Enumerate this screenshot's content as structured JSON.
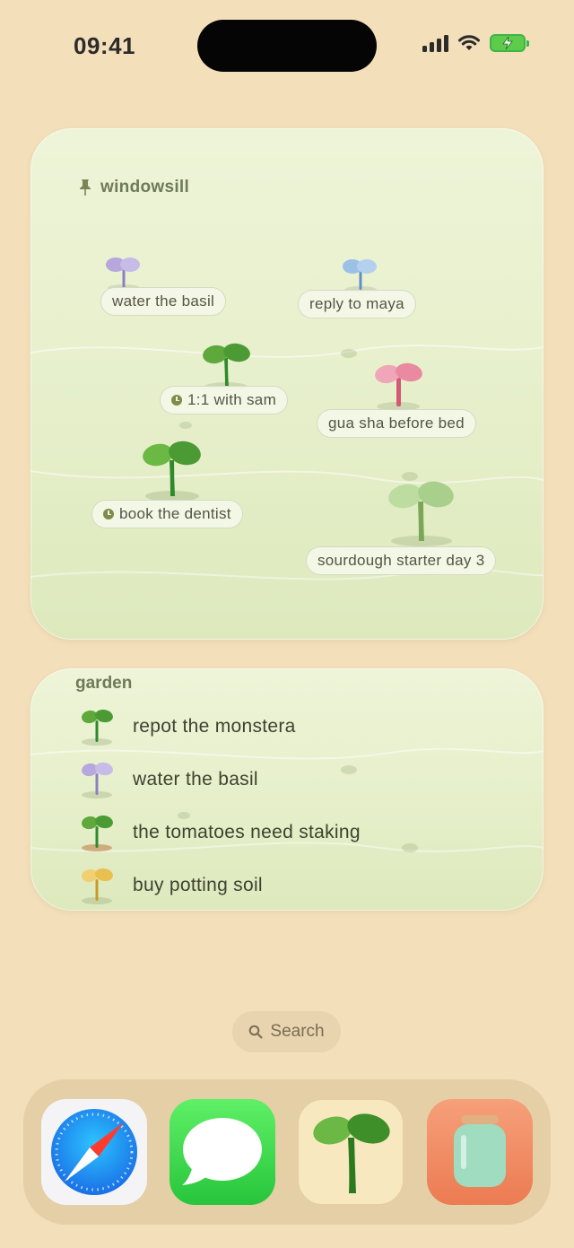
{
  "status": {
    "time": "09:41"
  },
  "windowsill": {
    "title": "windowsill",
    "items": [
      {
        "label": "water the basil",
        "color": "#b6a8dc",
        "has_clock": false
      },
      {
        "label": "reply to maya",
        "color": "#9cc0e6",
        "has_clock": false
      },
      {
        "label": "1:1 with sam",
        "color": "#5ea83c",
        "has_clock": true
      },
      {
        "label": "gua sha before bed",
        "color": "#e98aa0",
        "has_clock": false
      },
      {
        "label": "book the dentist",
        "color": "#5aa834",
        "has_clock": true
      },
      {
        "label": "sourdough starter day 3",
        "color": "#a9cf8c",
        "has_clock": false
      }
    ]
  },
  "garden": {
    "title": "garden",
    "items": [
      {
        "label": "repot the monstera",
        "color": "#4ca83a"
      },
      {
        "label": "water the basil",
        "color": "#b6a8dc"
      },
      {
        "label": "the tomatoes need staking",
        "color": "#4ca83a"
      },
      {
        "label": "buy potting soil",
        "color": "#e8c050"
      }
    ]
  },
  "search": {
    "label": "Search"
  },
  "dock": {
    "apps": [
      {
        "name": "Safari",
        "icon": "safari-icon"
      },
      {
        "name": "Messages",
        "icon": "messages-icon"
      },
      {
        "name": "Sprout",
        "icon": "sprout-app-icon"
      },
      {
        "name": "Jar",
        "icon": "jar-app-icon"
      }
    ]
  }
}
